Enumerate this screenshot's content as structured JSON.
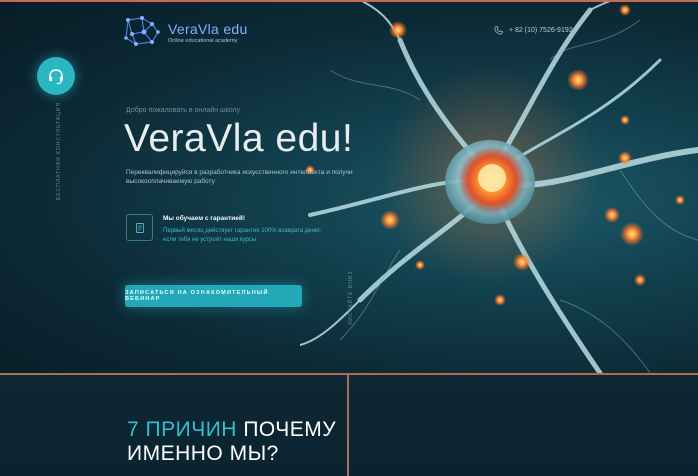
{
  "header": {
    "logo_name": "VeraVla edu",
    "logo_tagline": "Online educational academy",
    "phone": "+ 82 (10) 7526-9192"
  },
  "side": {
    "vertical_left": "БЕСПЛАТНАЯ КОНСУЛЬТАЦИЯ",
    "vertical_mid": "ЛИСТАЙТЕ ВНИЗ"
  },
  "hero": {
    "welcome": "Добро пожаловать в онлайн школу",
    "title": "VeraVla edu!",
    "subtitle": "Переквалифицируйся в разработчика искусственного интеллекта и получи высокооплачиваемую работу",
    "guarantee_title": "Мы обучаем с гарантией!",
    "guarantee_text": "Первый месяц действует гарантия 100% возврата денег, если тебя не устроят наши курсы",
    "cta_label": "ЗАПИСАТЬСЯ НА ОЗНАКОМИТЕЛЬНЫЙ ВЕБИНАР"
  },
  "reasons": {
    "accent": "7 ПРИЧИН",
    "rest_line1": "ПОЧЕМУ",
    "line2": "ИМЕННО МЫ?"
  },
  "colors": {
    "accent": "#2ec1d2",
    "border": "#b06a58",
    "background": "#0a1f2a"
  },
  "icons": [
    "logo-icon",
    "phone-icon",
    "headset-icon",
    "guarantee-icon"
  ]
}
